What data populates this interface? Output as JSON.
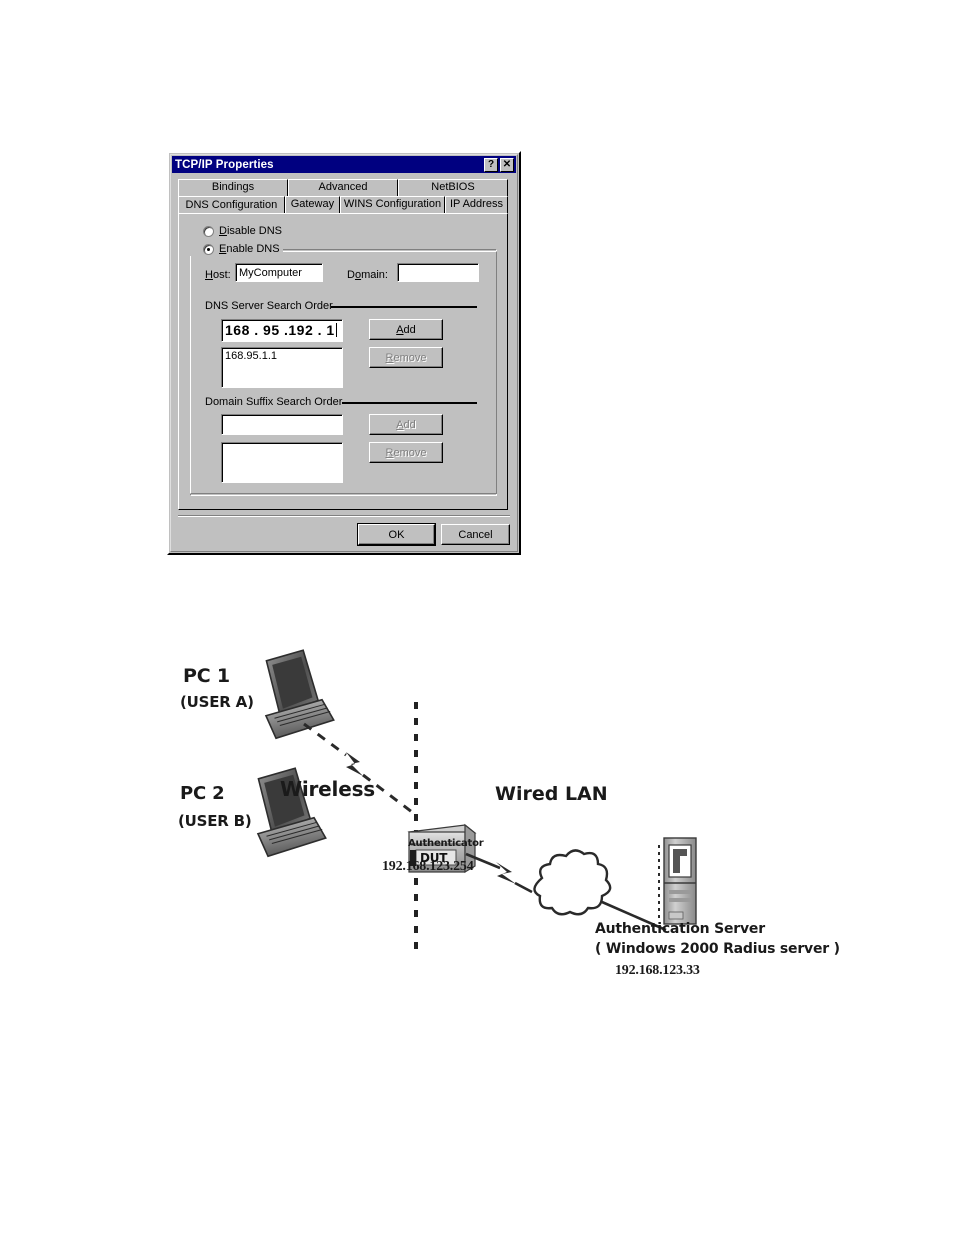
{
  "dialog": {
    "title": "TCP/IP Properties",
    "titlebar_buttons": [
      {
        "name": "help-button",
        "label": "?"
      },
      {
        "name": "close-button",
        "label": "✕"
      }
    ],
    "tabs_top": [
      "Bindings",
      "Advanced",
      "NetBIOS"
    ],
    "tabs_bottom": [
      "DNS Configuration",
      "Gateway",
      "WINS Configuration",
      "IP Address"
    ],
    "active_tab": "DNS Configuration",
    "radio_disable_label": "Disable DNS",
    "radio_enable_label": "Enable DNS",
    "dns_enabled": true,
    "host_label": "Host:",
    "host_value": "MyComputer",
    "domain_label": "Domain:",
    "domain_value": "",
    "dns_group_label": "DNS Server Search Order",
    "dns_ip_entry": "168 . 95 .192 . 1",
    "dns_list": [
      "168.95.1.1"
    ],
    "dns_add_label": "Add",
    "dns_remove_label": "Remove",
    "suffix_group_label": "Domain Suffix Search Order",
    "suffix_entry": "",
    "suffix_list": [],
    "suffix_add_label": "Add",
    "suffix_remove_label": "Remove",
    "ok_label": "OK",
    "cancel_label": "Cancel",
    "colors": {
      "titlebar": "#000080",
      "face": "#c0c0c0",
      "field": "#ffffff",
      "disabled_text": "#808080"
    }
  },
  "diagram": {
    "pc1_name": "PC 1",
    "pc1_user": "(USER A)",
    "pc2_name": "PC 2",
    "pc2_user": "(USER B)",
    "wireless_label": "Wireless",
    "wired_label": "Wired  LAN",
    "dut_label": "DUT",
    "authenticator_label": "Authenticator",
    "authenticator_ip": "192.168.123.254",
    "server_line1": "Authentication Server",
    "server_line2": "( Windows 2000 Radius server )",
    "server_ip": "192.168.123.33"
  }
}
